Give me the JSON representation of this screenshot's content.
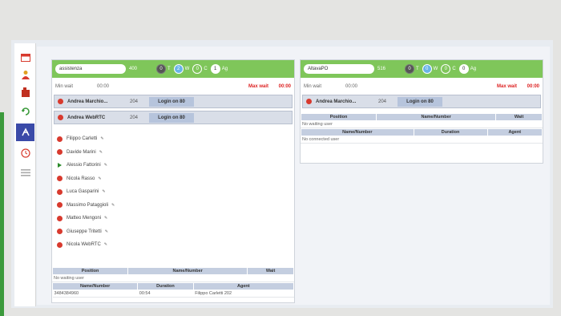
{
  "sidebar": {
    "items": [
      {
        "icon": "calendar-icon"
      },
      {
        "icon": "user-icon"
      },
      {
        "icon": "building-icon"
      },
      {
        "icon": "phone-transfer-icon"
      },
      {
        "icon": "queue-icon",
        "active": true
      },
      {
        "icon": "clock-icon"
      },
      {
        "icon": "list-icon"
      }
    ]
  },
  "queues": [
    {
      "name": "assistenza",
      "count": "400",
      "stats": {
        "t_label": "T",
        "t_value": "0",
        "w_label": "W",
        "w_value": "2",
        "c_label": "C",
        "c_value": "0",
        "a_value": "1",
        "a_label": "Ag"
      },
      "min_wait_label": "Min wait",
      "min_wait_value": "00:00",
      "max_wait_label": "Max wait",
      "max_wait_value": "00:00",
      "agents": [
        {
          "name": "Andrea Marchio...",
          "ext": "204",
          "button": "Login on 80"
        },
        {
          "name": "Andrea WebRTC",
          "ext": "204",
          "button": "Login on 80"
        }
      ],
      "members": [
        {
          "name": "Filippo Carletti",
          "status": "red"
        },
        {
          "name": "Davide Marini",
          "status": "red"
        },
        {
          "name": "Alessio Fattorini",
          "status": "green"
        },
        {
          "name": "Nicola Rasso",
          "status": "red"
        },
        {
          "name": "Luca Gasparini",
          "status": "red"
        },
        {
          "name": "Massimo Pataggioli",
          "status": "red"
        },
        {
          "name": "Matteo Mengoni",
          "status": "red"
        },
        {
          "name": "Giuseppe Tritetti",
          "status": "red"
        },
        {
          "name": "Nicola WebRTC",
          "status": "red"
        }
      ],
      "waiting_headers": [
        "Position",
        "Name/Number",
        "Wait"
      ],
      "waiting_note": "No waiting user",
      "connected_headers": [
        "Name/Number",
        "Duration",
        "Agent"
      ],
      "connected_rows": [
        [
          "3484384960",
          "00:54",
          "Filippo Carletti 202"
        ]
      ]
    },
    {
      "name": "AltavaPO",
      "count": "516",
      "stats": {
        "t_label": "T",
        "t_value": "0",
        "w_label": "W",
        "w_value": "0",
        "c_label": "C",
        "c_value": "0",
        "a_value": "0",
        "a_label": "Ag"
      },
      "min_wait_label": "Min wait",
      "min_wait_value": "00:00",
      "max_wait_label": "Max wait",
      "max_wait_value": "00:00",
      "agents": [
        {
          "name": "Andrea Marchio...",
          "ext": "204",
          "button": "Login on 80"
        }
      ],
      "waiting_headers": [
        "Position",
        "Name/Number",
        "Wait"
      ],
      "waiting_note": "No waiting user",
      "connected_headers": [
        "Name/Number",
        "Duration",
        "Agent"
      ],
      "connected_note": "No connected user"
    }
  ]
}
